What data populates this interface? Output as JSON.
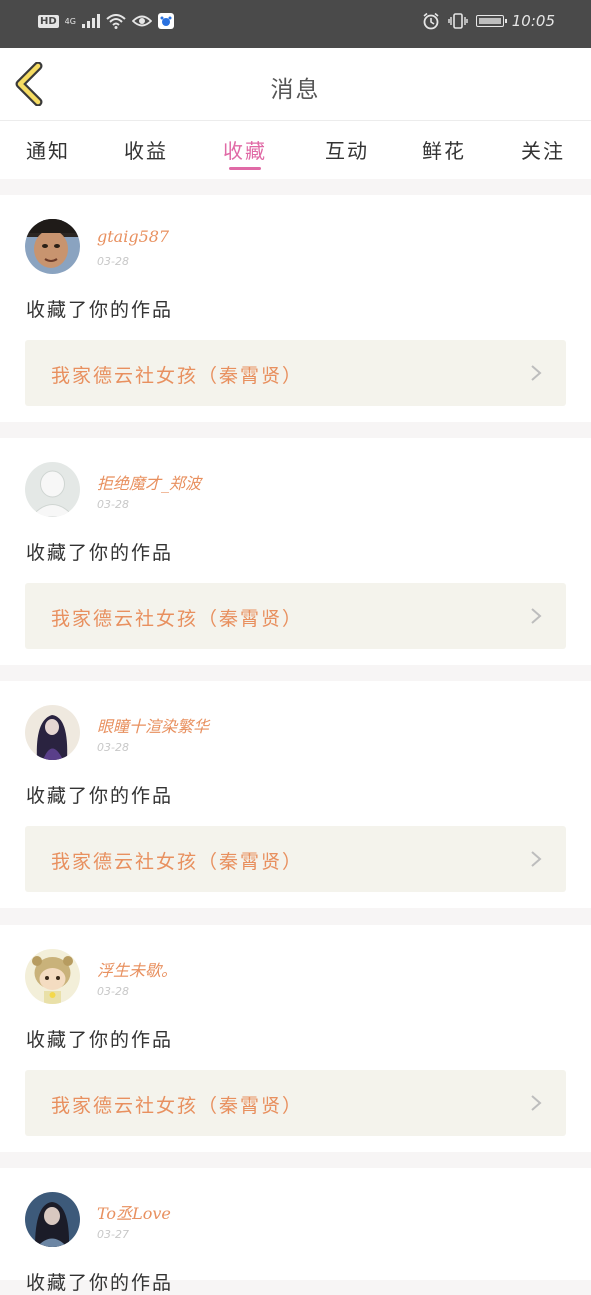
{
  "status_bar": {
    "network_badge": "HD",
    "network_type": "4G",
    "time": "10:05"
  },
  "header": {
    "title": "消息"
  },
  "tabs": [
    {
      "label": "通知",
      "active": false
    },
    {
      "label": "收益",
      "active": false
    },
    {
      "label": "收藏",
      "active": true
    },
    {
      "label": "互动",
      "active": false
    },
    {
      "label": "鲜花",
      "active": false
    },
    {
      "label": "关注",
      "active": false
    }
  ],
  "messages": [
    {
      "username": "gtaig587",
      "date": "03-28",
      "action": "收藏了你的作品",
      "work_title": "我家德云社女孩（秦霄贤）"
    },
    {
      "username": "拒绝魔才_郑波",
      "date": "03-28",
      "action": "收藏了你的作品",
      "work_title": "我家德云社女孩（秦霄贤）"
    },
    {
      "username": "眼瞳十渲染繁华",
      "date": "03-28",
      "action": "收藏了你的作品",
      "work_title": "我家德云社女孩（秦霄贤）"
    },
    {
      "username": "浮生未歇。",
      "date": "03-28",
      "action": "收藏了你的作品",
      "work_title": "我家德云社女孩（秦霄贤）"
    },
    {
      "username": "To丞Love",
      "date": "03-27",
      "action": "收藏了你的作品",
      "work_title": ""
    }
  ],
  "colors": {
    "accent": "#e06aa6",
    "username": "#e8905f",
    "card_bg": "#f4f3ec"
  }
}
